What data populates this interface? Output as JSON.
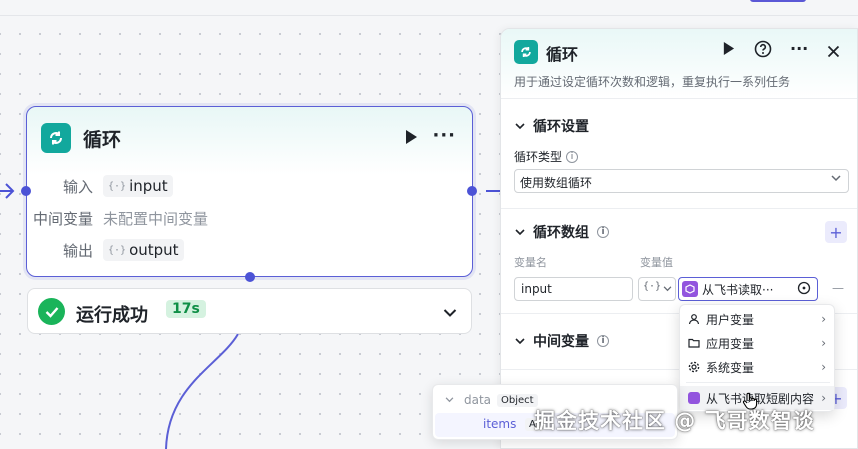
{
  "node": {
    "title": "循环",
    "rows": [
      {
        "label": "输入",
        "chip": "input"
      },
      {
        "label": "中间变量",
        "text": "未配置中间变量"
      },
      {
        "label": "输出",
        "chip": "output"
      }
    ]
  },
  "status": {
    "text": "运行成功",
    "time": "17s"
  },
  "panel": {
    "title": "循环",
    "description": "用于通过设定循环次数和逻辑，重复执行一系列任务",
    "loop_settings": {
      "title": "循环设置",
      "type_label": "循环类型",
      "type_value": "使用数组循环"
    },
    "loop_array": {
      "title": "循环数组",
      "var_name_label": "变量名",
      "var_value_label": "变量值",
      "var_name": "input",
      "var_value": "从飞书读取···"
    },
    "intermediate": {
      "title": "中间变量"
    }
  },
  "menu": {
    "items": [
      {
        "label": "用户变量",
        "icon": "user-icon"
      },
      {
        "label": "应用变量",
        "icon": "folder-icon"
      },
      {
        "label": "系统变量",
        "icon": "gear-icon"
      },
      {
        "label": "从飞书读取短剧内容",
        "icon": "cube-icon"
      }
    ]
  },
  "tree": {
    "root_name": "data",
    "root_type": "Object",
    "child_name": "items",
    "child_type": "Ar"
  },
  "watermark": "掘金技术社区 @ 飞哥数智谈",
  "colors": {
    "accent": "#5b5fd6",
    "teal": "#12a89d",
    "success": "#1ab45a"
  }
}
